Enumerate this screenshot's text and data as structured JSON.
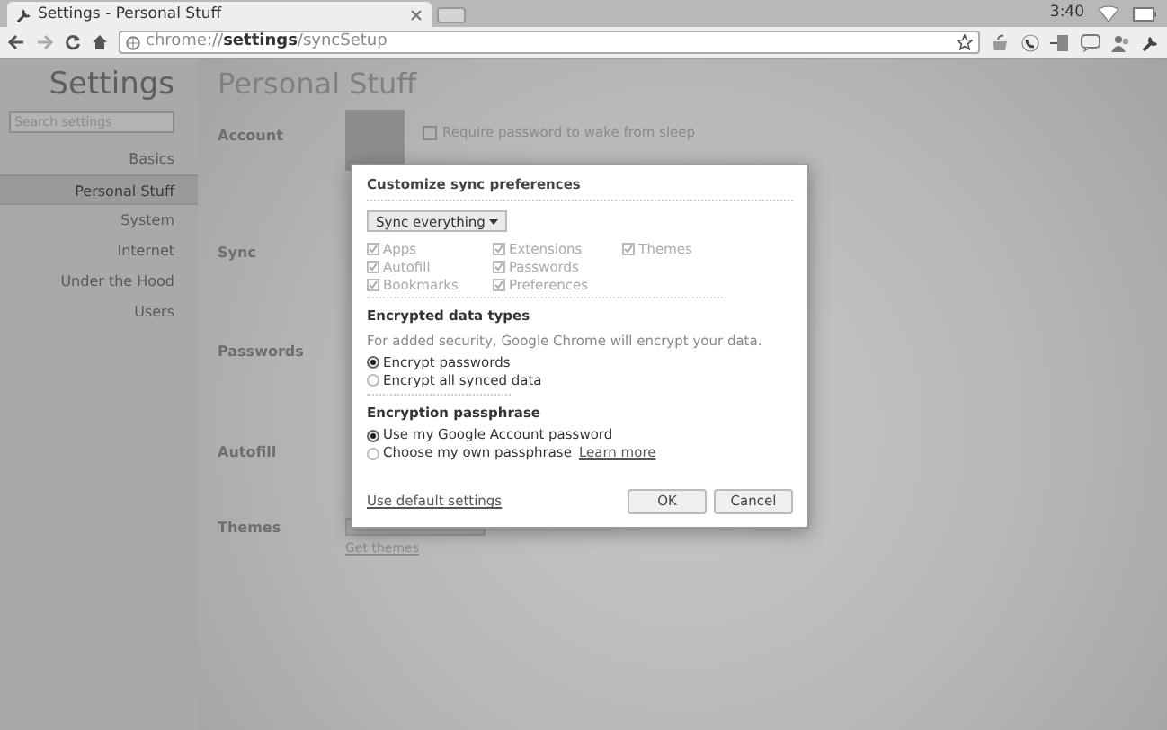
{
  "browser": {
    "tab_title": "Settings - Personal Stuff",
    "clock": "3:40",
    "url": {
      "scheme": "chrome://",
      "host": "settings",
      "path": "/syncSetup"
    }
  },
  "sidebar": {
    "title": "Settings",
    "search": {
      "placeholder": "Search settings"
    },
    "items": [
      {
        "label": "Basics",
        "selected": false
      },
      {
        "label": "Personal Stuff",
        "selected": true
      },
      {
        "label": "System",
        "selected": false
      },
      {
        "label": "Internet",
        "selected": false
      },
      {
        "label": "Under the Hood",
        "selected": false
      },
      {
        "label": "Users",
        "selected": false
      }
    ]
  },
  "page": {
    "title": "Personal Stuff",
    "sections": [
      {
        "label": "Account",
        "text": "Require password to wake from sleep",
        "checked": false
      },
      {
        "label": "Sync"
      },
      {
        "label": "Passwords"
      },
      {
        "label": "Autofill"
      },
      {
        "label": "Themes",
        "link": "Get themes"
      }
    ]
  },
  "dialog": {
    "title": "Customize sync preferences",
    "dropdown": "Sync everything",
    "data_types": [
      {
        "label": "Apps",
        "checked": true
      },
      {
        "label": "Autofill",
        "checked": true
      },
      {
        "label": "Bookmarks",
        "checked": true
      },
      {
        "label": "Extensions",
        "checked": true
      },
      {
        "label": "Passwords",
        "checked": true
      },
      {
        "label": "Preferences",
        "checked": true
      },
      {
        "label": "Themes",
        "checked": true
      }
    ],
    "encrypted_heading": "Encrypted data types",
    "encrypted_note": "For added security, Google Chrome will encrypt your data.",
    "encrypt_options": [
      {
        "label": "Encrypt passwords",
        "selected": true
      },
      {
        "label": "Encrypt all synced data",
        "selected": false
      }
    ],
    "passphrase_heading": "Encryption passphrase",
    "passphrase_options": [
      {
        "label": "Use my Google Account password",
        "selected": true
      },
      {
        "label": "Choose my own passphrase",
        "selected": false,
        "link": "Learn more"
      }
    ],
    "default_link": "Use default settings",
    "buttons": [
      "OK",
      "Cancel"
    ]
  }
}
